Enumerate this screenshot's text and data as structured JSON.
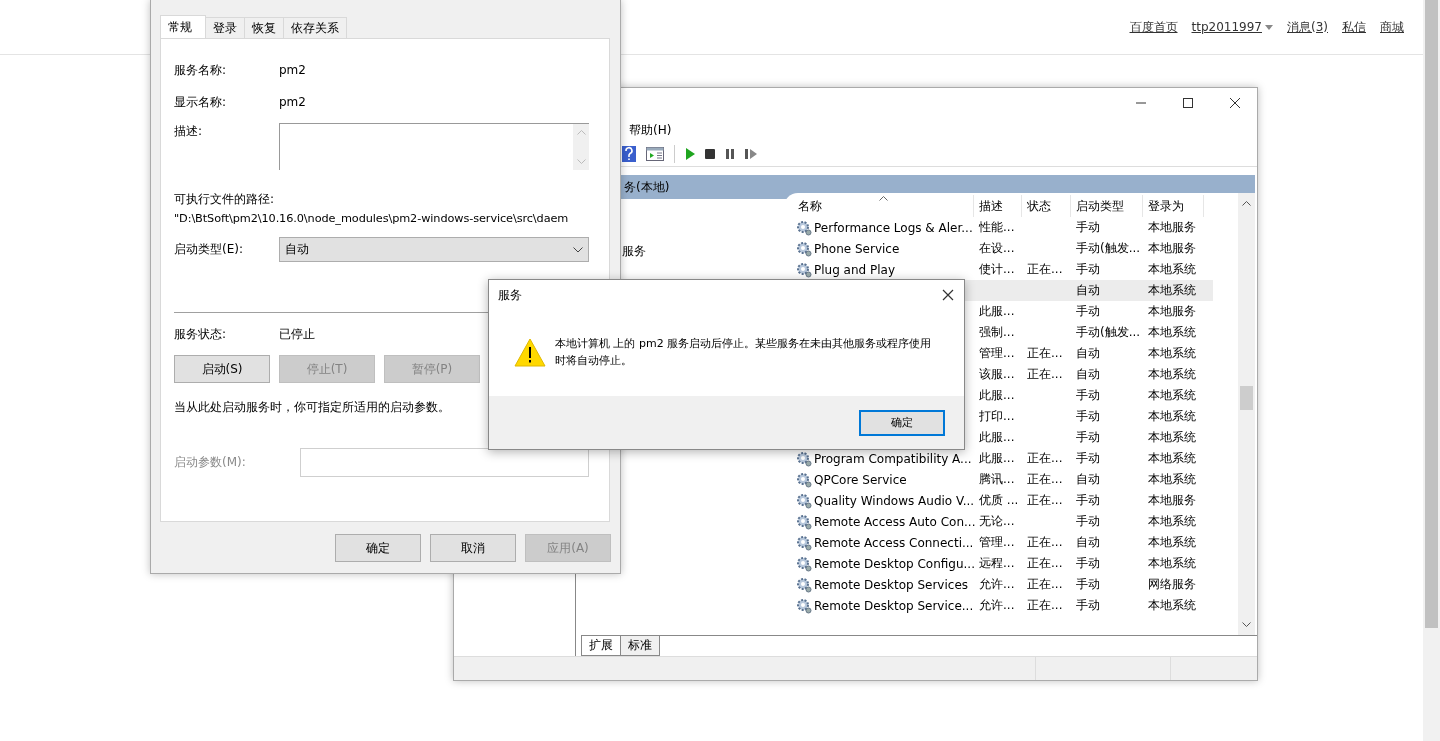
{
  "page_nav": {
    "links": [
      {
        "label": "百度首页",
        "kind": "link"
      },
      {
        "label": "ttp2011997",
        "kind": "menu"
      },
      {
        "label": "消息(3)",
        "kind": "link"
      },
      {
        "label": "私信",
        "kind": "link"
      },
      {
        "label": "商城",
        "kind": "link"
      }
    ]
  },
  "services_window": {
    "menu": [
      "帮助(H)"
    ],
    "header": "务(本地)",
    "description_title": "服务",
    "columns": [
      "名称",
      "描述",
      "状态",
      "启动类型",
      "登录为"
    ],
    "rows": [
      {
        "name": "Performance Logs & Aler...",
        "description": "性能...",
        "status": "",
        "startup": "手动",
        "logon": "本地服务",
        "selected": false
      },
      {
        "name": "Phone Service",
        "description": "在设...",
        "status": "",
        "startup": "手动(触发...",
        "logon": "本地服务",
        "selected": false
      },
      {
        "name": "Plug and Play",
        "description": "使计...",
        "status": "正在...",
        "startup": "手动",
        "logon": "本地系统",
        "selected": false
      },
      {
        "description": "",
        "status": "",
        "startup": "自动",
        "logon": "本地系统",
        "selected": true
      },
      {
        "description": "此服...",
        "status": "",
        "startup": "手动",
        "logon": "本地服务",
        "selected": false
      },
      {
        "description": "强制...",
        "status": "",
        "startup": "手动(触发...",
        "logon": "本地系统",
        "selected": false
      },
      {
        "description": "管理...",
        "status": "正在...",
        "startup": "自动",
        "logon": "本地系统",
        "selected": false
      },
      {
        "description": "该服...",
        "status": "正在...",
        "startup": "自动",
        "logon": "本地系统",
        "selected": false
      },
      {
        "description": "此服...",
        "status": "",
        "startup": "手动",
        "logon": "本地系统",
        "selected": false
      },
      {
        "description": "打印...",
        "status": "",
        "startup": "手动",
        "logon": "本地系统",
        "selected": false
      },
      {
        "description": "此服...",
        "status": "",
        "startup": "手动",
        "logon": "本地系统",
        "selected": false
      },
      {
        "name": "Program Compatibility A...",
        "description": "此服...",
        "status": "正在...",
        "startup": "手动",
        "logon": "本地系统",
        "selected": false
      },
      {
        "name": "QPCore Service",
        "description": "腾讯...",
        "status": "正在...",
        "startup": "自动",
        "logon": "本地系统",
        "selected": false
      },
      {
        "name": "Quality Windows Audio V...",
        "description": "优质 ...",
        "status": "正在...",
        "startup": "手动",
        "logon": "本地服务",
        "selected": false
      },
      {
        "name": "Remote Access Auto Con...",
        "description": "无论...",
        "status": "",
        "startup": "手动",
        "logon": "本地系统",
        "selected": false
      },
      {
        "name": "Remote Access Connecti...",
        "description": "管理...",
        "status": "正在...",
        "startup": "自动",
        "logon": "本地系统",
        "selected": false
      },
      {
        "name": "Remote Desktop Configu...",
        "description": "远程...",
        "status": "正在...",
        "startup": "手动",
        "logon": "本地系统",
        "selected": false
      },
      {
        "name": "Remote Desktop Services",
        "description": "允许...",
        "status": "正在...",
        "startup": "手动",
        "logon": "网络服务",
        "selected": false
      },
      {
        "name": "Remote Desktop Service...",
        "description": "允许...",
        "status": "正在...",
        "startup": "手动",
        "logon": "本地系统",
        "selected": false
      }
    ],
    "bottom_tabs": [
      {
        "label": "扩展",
        "selected": true
      },
      {
        "label": "标准",
        "selected": false
      }
    ]
  },
  "properties_dialog": {
    "tabs": [
      {
        "label": "常规",
        "selected": true
      },
      {
        "label": "登录",
        "selected": false
      },
      {
        "label": "恢复",
        "selected": false
      },
      {
        "label": "依存关系",
        "selected": false
      }
    ],
    "service_name_label": "服务名称:",
    "service_name": "pm2",
    "display_name_label": "显示名称:",
    "display_name": "pm2",
    "description_label": "描述:",
    "path_label": "可执行文件的路径:",
    "path": "\"D:\\BtSoft\\pm2\\10.16.0\\node_modules\\pm2-windows-service\\src\\daem",
    "startup_type_label": "启动类型(E):",
    "startup_type": "自动",
    "status_label": "服务状态:",
    "status": "已停止",
    "control_buttons": [
      {
        "label": "启动(S)",
        "disabled": false
      },
      {
        "label": "停止(T)",
        "disabled": true
      },
      {
        "label": "暂停(P)",
        "disabled": true
      }
    ],
    "hint": "当从此处启动服务时，你可指定所适用的启动参数。",
    "params_label": "启动参数(M):",
    "params_disabled": true,
    "buttons": [
      {
        "label": "确定",
        "disabled": false
      },
      {
        "label": "取消",
        "disabled": false
      },
      {
        "label": "应用(A)",
        "disabled": true
      }
    ]
  },
  "message_box": {
    "title": "服务",
    "message": "本地计算机 上的 pm2 服务启动后停止。某些服务在未由其他服务或程序使用时将自动停止。",
    "button": "确定"
  }
}
